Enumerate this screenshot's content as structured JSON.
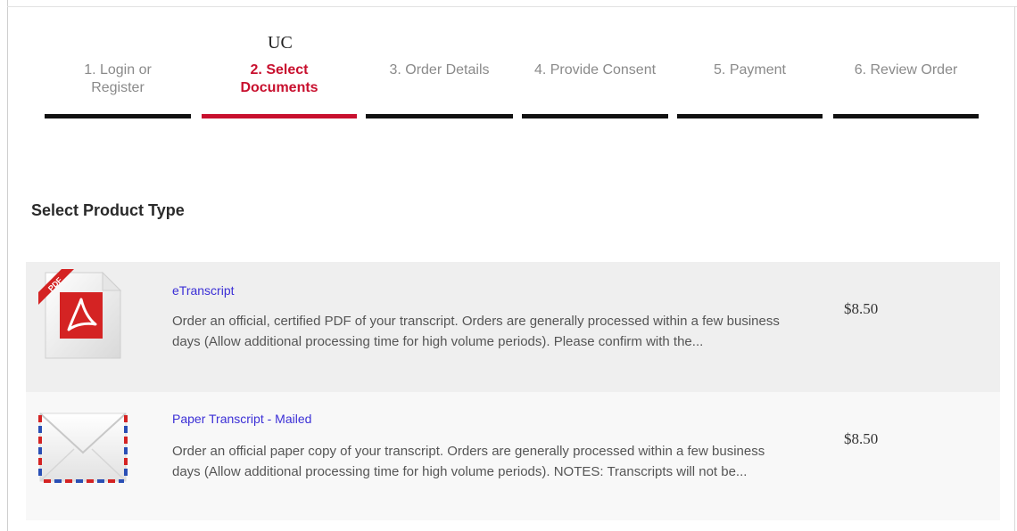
{
  "header": {
    "logo_text": "UC"
  },
  "steps": [
    {
      "label": "1. Login or Register",
      "active": false
    },
    {
      "label": "2. Select Documents",
      "active": true
    },
    {
      "label": "3. Order Details",
      "active": false
    },
    {
      "label": "4. Provide Consent",
      "active": false
    },
    {
      "label": "5. Payment",
      "active": false
    },
    {
      "label": "6. Review Order",
      "active": false
    }
  ],
  "section": {
    "title": "Select Product Type"
  },
  "products": [
    {
      "name": "eTranscript",
      "icon": "pdf-document-icon",
      "description": "Order an official, certified PDF of your transcript. Orders are generally processed within a few business days (Allow additional processing time for high volume periods). Please confirm with the...",
      "price": "$8.50"
    },
    {
      "name": "Paper Transcript - Mailed",
      "icon": "envelope-icon",
      "description": "Order an official paper copy of your transcript. Orders are generally processed within a few business days (Allow additional processing time for high volume periods). NOTES: Transcripts will not be...",
      "price": "$8.50"
    }
  ],
  "colors": {
    "active_step": "#c8102e",
    "inactive_bar": "#111111",
    "link": "#3b2fd6"
  }
}
